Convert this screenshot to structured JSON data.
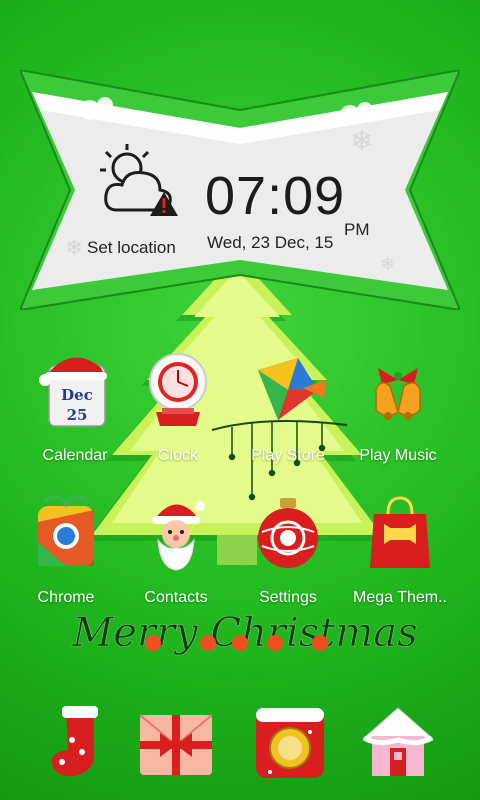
{
  "widget": {
    "time": "07:09",
    "ampm": "PM",
    "date": "Wed, 23 Dec, 15",
    "location_label": "Set location"
  },
  "apps": [
    {
      "label": "Calendar",
      "icon": "calendar-icon",
      "badge_month": "Dec",
      "badge_day": "25"
    },
    {
      "label": "Clock",
      "icon": "snowglobe-clock-icon"
    },
    {
      "label": "Play Store",
      "icon": "play-store-icon"
    },
    {
      "label": "Play Music",
      "icon": "bells-icon"
    },
    {
      "label": "Chrome",
      "icon": "chrome-icon"
    },
    {
      "label": "Contacts",
      "icon": "santa-icon"
    },
    {
      "label": "Settings",
      "icon": "ornament-icon"
    },
    {
      "label": "Mega Them..",
      "icon": "gift-bag-icon"
    }
  ],
  "greeting": "Merry Christmas",
  "dock": [
    {
      "icon": "stocking-icon"
    },
    {
      "icon": "gift-envelope-icon"
    },
    {
      "icon": "camera-icon"
    },
    {
      "icon": "house-icon"
    }
  ],
  "colors": {
    "background": "#22b81f",
    "tree_light": "#d4f86a",
    "accent_red": "#d81e1e"
  }
}
